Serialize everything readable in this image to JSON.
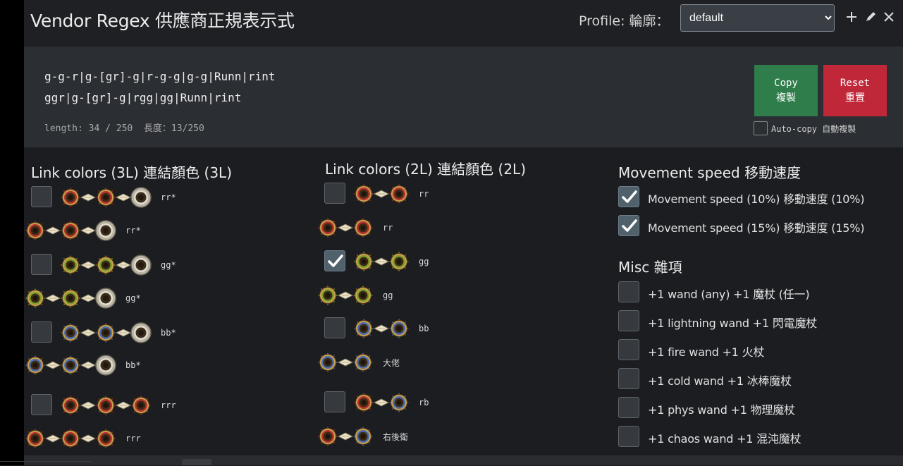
{
  "header": {
    "title": "Vendor Regex 供應商正規表示式",
    "profile_label": "Profile: 輪廓：",
    "profile_selected": "default",
    "profile_options": [
      "default"
    ]
  },
  "regex": {
    "line1": "g-g-r|g-[gr]-g|r-g-g|g-g|Runn|rint",
    "line2": "ggr|g-[gr]-g|rgg|gg|Runn|rint",
    "length": "length: 34 / 250  長度：13/250",
    "copy_label_en": "Copy",
    "copy_label_zh": "複製",
    "reset_label_en": "Reset",
    "reset_label_zh": "重置",
    "autocopy_label": "Auto-copy  自動複製",
    "autocopy_checked": false
  },
  "links3": {
    "title": "Link colors (3L) 連結顏色 (3L)",
    "rows": [
      {
        "checkbox": true,
        "checked": false,
        "sockets": [
          "red",
          "red",
          "white"
        ],
        "label": "rr*"
      },
      {
        "checkbox": false,
        "sockets": [
          "red",
          "red",
          "white"
        ],
        "label": "rr*"
      },
      {
        "checkbox": true,
        "checked": false,
        "sockets": [
          "green",
          "green",
          "white"
        ],
        "label": "gg*"
      },
      {
        "checkbox": false,
        "sockets": [
          "green",
          "green",
          "white"
        ],
        "label": "gg*"
      },
      {
        "checkbox": true,
        "checked": false,
        "sockets": [
          "blue",
          "blue",
          "white"
        ],
        "label": "bb*"
      },
      {
        "checkbox": false,
        "sockets": [
          "blue",
          "blue",
          "white"
        ],
        "label": "bb*"
      },
      {
        "checkbox": true,
        "checked": false,
        "sockets": [
          "red",
          "red",
          "red"
        ],
        "label": "rrr"
      },
      {
        "checkbox": false,
        "sockets": [
          "red",
          "red",
          "red"
        ],
        "label": "rrr"
      }
    ]
  },
  "links2": {
    "title": "Link colors (2L) 連結顏色 (2L)",
    "rows": [
      {
        "checkbox": true,
        "checked": false,
        "sockets": [
          "red",
          "red"
        ],
        "label": "rr"
      },
      {
        "checkbox": false,
        "sockets": [
          "red",
          "red"
        ],
        "label": "rr"
      },
      {
        "checkbox": true,
        "checked": true,
        "sockets": [
          "green",
          "green"
        ],
        "label": "gg"
      },
      {
        "checkbox": false,
        "sockets": [
          "green",
          "green"
        ],
        "label": "gg"
      },
      {
        "checkbox": true,
        "checked": false,
        "sockets": [
          "blue",
          "blue"
        ],
        "label": "bb"
      },
      {
        "checkbox": false,
        "sockets": [
          "blue",
          "blue"
        ],
        "label": "大佬"
      },
      {
        "checkbox": true,
        "checked": false,
        "sockets": [
          "red",
          "blue"
        ],
        "label": "rb"
      },
      {
        "checkbox": false,
        "sockets": [
          "red",
          "blue"
        ],
        "label": "右後衛"
      }
    ]
  },
  "movement": {
    "title": "Movement speed 移動速度",
    "items": [
      {
        "label": "Movement speed (10%) 移動速度 (10%)",
        "checked": true
      },
      {
        "label": "Movement speed (15%) 移動速度 (15%)",
        "checked": true
      }
    ]
  },
  "misc": {
    "title": "Misc 雜項",
    "items": [
      {
        "label": "+1 wand (any) +1 魔杖 (任一)",
        "checked": false
      },
      {
        "label": "+1 lightning wand +1 閃電魔杖",
        "checked": false
      },
      {
        "label": "+1 fire wand +1 火杖",
        "checked": false
      },
      {
        "label": "+1 cold wand +1 冰棒魔杖",
        "checked": false
      },
      {
        "label": "+1 phys wand +1 物理魔杖",
        "checked": false
      },
      {
        "label": "+1 chaos wand +1 混沌魔杖",
        "checked": false
      }
    ]
  },
  "colors": {
    "red": "#b8322c",
    "green": "#7fa12a",
    "blue": "#4d6fae",
    "white": "#d6d0c0",
    "copy": "#2e7d4a",
    "reset": "#c0283a"
  }
}
